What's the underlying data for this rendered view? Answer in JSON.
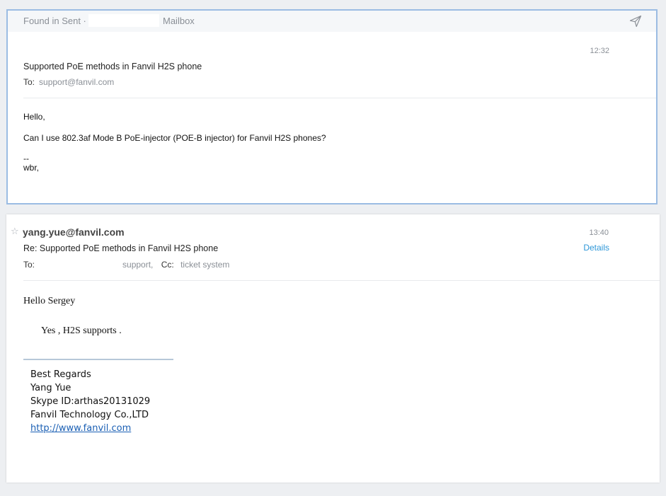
{
  "original_message": {
    "found_in_label": "Found in Sent ·",
    "mailbox_label": "Mailbox",
    "send_icon": "paper-plane-icon",
    "time": "12:32",
    "subject": "Supported PoE methods in Fanvil H2S phone",
    "to_label": "To:",
    "to_address": "support@fanvil.com",
    "body": {
      "greeting": "Hello,",
      "question": "Can I use 802.3af Mode B PoE-injector (POE-B injector) for Fanvil H2S phones?",
      "sig_dash": "--",
      "sign_off": "wbr,"
    }
  },
  "reply_message": {
    "star_icon": "star-icon",
    "sender": "yang.yue@fanvil.com",
    "time": "13:40",
    "details_label": "Details",
    "subject": "Re: Supported PoE methods in Fanvil H2S phone",
    "to_label": "To:",
    "to_recipient": "support,",
    "cc_label": "Cc:",
    "cc_recipient": "ticket system",
    "greeting": "Hello Sergey",
    "reply_text": "Yes , H2S supports .",
    "signature": {
      "regards": "Best Regards",
      "name": "Yang Yue",
      "skype": "Skype ID:arthas20131029",
      "company": "Fanvil Technology Co.,LTD",
      "website": "http://www.fanvil.com"
    }
  },
  "colors": {
    "selected_border": "#9bbce3",
    "link": "#1a5fb4",
    "details_link": "#2e97d8",
    "muted_text": "#8a8f96"
  }
}
